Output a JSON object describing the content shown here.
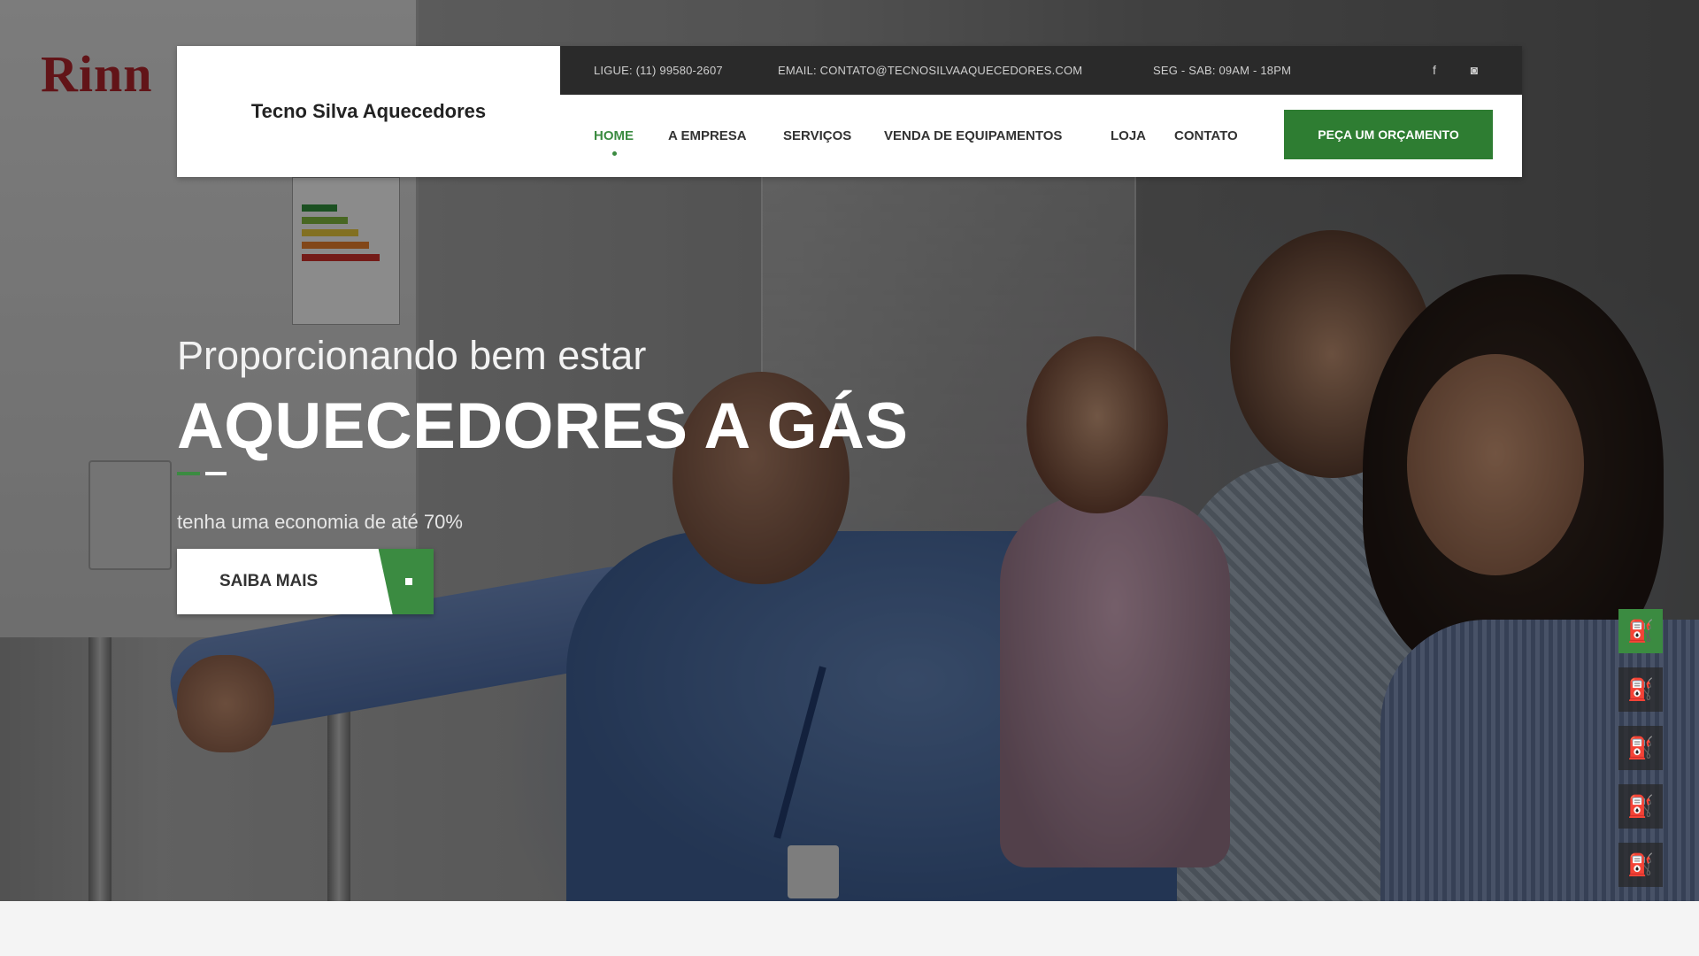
{
  "header": {
    "logo_text": "Tecno Silva Aquecedores",
    "topbar": {
      "phone": "LIGUE: (11) 99580-2607",
      "email": "EMAIL: CONTATO@TECNOSILVAAQUECEDORES.COM",
      "hours": "SEG - SAB: 09AM - 18PM",
      "social": [
        {
          "icon": "facebook-icon",
          "glyph": "f"
        },
        {
          "icon": "instagram-icon",
          "glyph": "◙"
        }
      ]
    },
    "nav": [
      {
        "label": "HOME",
        "active": true
      },
      {
        "label": "A EMPRESA",
        "active": false
      },
      {
        "label": "SERVIÇOS",
        "active": false
      },
      {
        "label": "VENDA DE EQUIPAMENTOS",
        "active": false
      },
      {
        "label": "LOJA",
        "active": false
      },
      {
        "label": "CONTATO",
        "active": false
      }
    ],
    "quote_button": "PEÇA UM ORÇAMENTO"
  },
  "hero": {
    "subtitle": "Proporcionando bem estar",
    "title": "AQUECEDORES A GÁS",
    "text": "tenha uma economia de até 70%",
    "cta_label": "SAIBA MAIS",
    "background_brand": "Rinn"
  },
  "slider": {
    "icon": "slide-thumb-icon",
    "glyph": "⛽",
    "items": [
      {
        "active": true
      },
      {
        "active": false
      },
      {
        "active": false
      },
      {
        "active": false
      },
      {
        "active": false
      }
    ]
  },
  "colors": {
    "accent": "#3b8b41",
    "button_green": "#2e7d32",
    "topbar_bg": "#2a2a2a"
  }
}
